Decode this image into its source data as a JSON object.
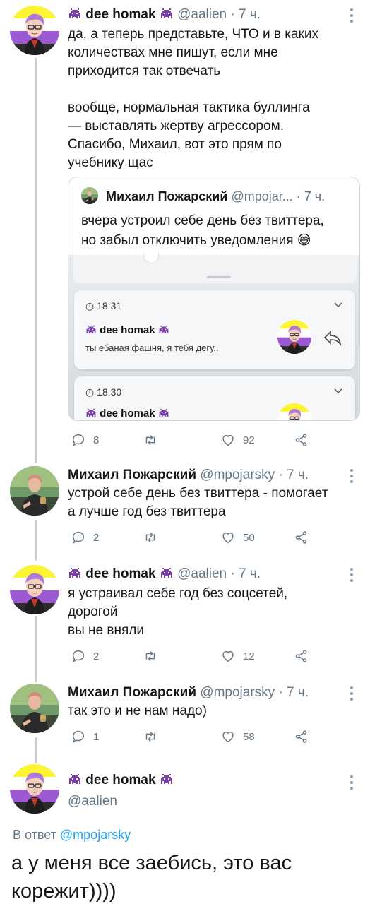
{
  "accent_blue": "#1da1f2",
  "tweets": [
    {
      "name": "dee homak",
      "handle": "@aalien",
      "time": "7 ч.",
      "text": "да, а теперь представьте, ЧТО и в каких\nколичествах мне пишут, если мне\nприходится так отвечать\n\nвообще, нормальная тактика буллинга\n— выставлять жертву агрессором.\nСпасибо, Михаил, вот это прям по\nучебнику щас",
      "quote": {
        "name": "Михаил Пожарский",
        "handle": "@mpojar...",
        "time": "7 ч.",
        "text": "вчера устроил себе день без твиттера,\nно забыл отключить уведомления 😅",
        "notifications": [
          {
            "time": "18:31",
            "title": "dee homak",
            "body": "ты ебаная фашня, я тебя дегу.."
          },
          {
            "time": "18:30",
            "title": "dee homak",
            "body": ""
          }
        ]
      },
      "replies": "8",
      "retweets": "",
      "likes": "92"
    },
    {
      "name": "Михаил Пожарский",
      "handle": "@mpojarsky",
      "time": "7 ч.",
      "text": "устрой себе день без твиттера - помогает\nа лучше год без твиттера",
      "replies": "2",
      "retweets": "",
      "likes": "50"
    },
    {
      "name": "dee homak",
      "handle": "@aalien",
      "time": "7 ч.",
      "text": "я устраивал себе год без соцсетей,\nдорогой\nвы не вняли",
      "replies": "2",
      "retweets": "",
      "likes": "12"
    },
    {
      "name": "Михаил Пожарский",
      "handle": "@mpojarsky",
      "time": "7 ч.",
      "text": "так это и не нам надо)",
      "replies": "1",
      "retweets": "",
      "likes": "58"
    }
  ],
  "focus": {
    "name": "dee homak",
    "handle": "@aalien",
    "reply_prefix": "В ответ",
    "reply_handle": "@mpojarsky",
    "text": "а у меня все заебись, это вас корежит))))"
  }
}
